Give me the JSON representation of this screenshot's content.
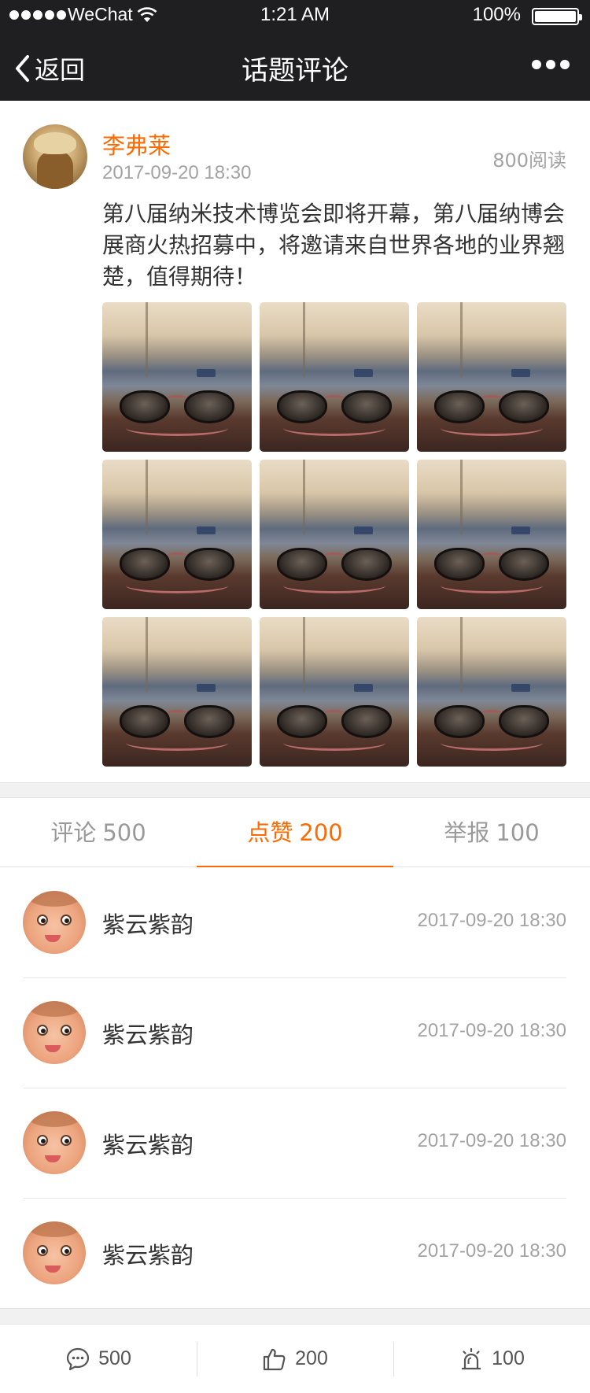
{
  "status_bar": {
    "carrier": "WeChat",
    "time": "1:21 AM",
    "battery": "100%"
  },
  "nav": {
    "back_label": "返回",
    "title": "话题评论"
  },
  "post": {
    "author": "李弗莱",
    "time": "2017-09-20 18:30",
    "reads": "800阅读",
    "text": "第八届纳米技术博览会即将开幕，第八届纳博会展商火热招募中，将邀请来自世界各地的业界翘楚，值得期待！",
    "image_count": 9
  },
  "tabs": [
    {
      "label": "评论",
      "count": "500",
      "active": false
    },
    {
      "label": "点赞",
      "count": "200",
      "active": true
    },
    {
      "label": "举报",
      "count": "100",
      "active": false
    }
  ],
  "likes": [
    {
      "name": "紫云紫韵",
      "time": "2017-09-20 18:30"
    },
    {
      "name": "紫云紫韵",
      "time": "2017-09-20 18:30"
    },
    {
      "name": "紫云紫韵",
      "time": "2017-09-20 18:30"
    },
    {
      "name": "紫云紫韵",
      "time": "2017-09-20 18:30"
    }
  ],
  "bottom_bar": {
    "comment_count": "500",
    "like_count": "200",
    "report_count": "100"
  },
  "colors": {
    "accent": "#ff6a00",
    "topbar": "#1f1f21",
    "muted_text": "#a3a3a3"
  }
}
